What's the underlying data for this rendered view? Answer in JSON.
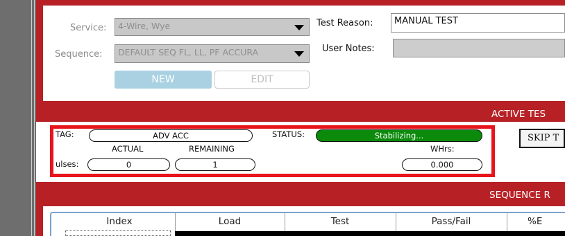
{
  "setup": {
    "service_label": "Service:",
    "service_value": "4-Wire, Wye",
    "sequence_label": "Sequence:",
    "sequence_value": "DEFAULT SEQ FL, LL, PF ACCURA",
    "test_reason_label": "Test Reason:",
    "test_reason_value": "MANUAL TEST",
    "user_notes_label": "User Notes:",
    "user_notes_value": "",
    "new_button": "NEW",
    "edit_button": "EDIT"
  },
  "active_test": {
    "title": "ACTIVE TES",
    "tag_label": "TAG:",
    "tag_value": "ADV ACC",
    "status_label": "STATUS:",
    "status_value": "Stabilizing...",
    "actual_label": "ACTUAL",
    "remaining_label": "REMAINING",
    "whrs_label": "WHrs:",
    "pulses_label": "ulses:",
    "actual_value": "0",
    "remaining_value": "1",
    "whrs_value": "0.000",
    "skip_button": "SKIP T"
  },
  "sequence_results": {
    "title": "SEQUENCE R",
    "columns": [
      "Index",
      "Load",
      "Test",
      "Pass/Fail",
      "%E"
    ]
  },
  "colors": {
    "band_red": "#b72126",
    "highlight_red": "#e8141c",
    "status_green": "#0b8a0b",
    "new_button_blue": "#a9d1e2",
    "table_border_blue": "#7aa2cf"
  }
}
